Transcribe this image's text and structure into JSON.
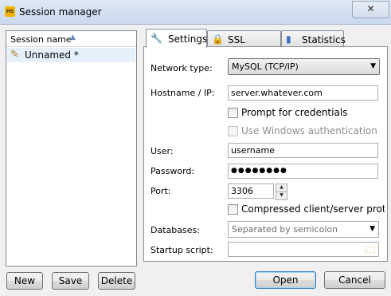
{
  "window": {
    "title": "Session manager",
    "app_icon": "HS",
    "close_glyph": "✕"
  },
  "session_list": {
    "header": "Session name",
    "items": [
      {
        "label": "Unnamed *"
      }
    ]
  },
  "tabs": [
    {
      "label": "Settings",
      "icon": "wrench-icon",
      "glyph": "🔧"
    },
    {
      "label": "SSL options",
      "icon": "lock-icon",
      "glyph": "🔒"
    },
    {
      "label": "Statistics",
      "icon": "bar-chart-icon",
      "glyph": "▮"
    }
  ],
  "settings": {
    "network_type": {
      "label": "Network type:",
      "value": "MySQL (TCP/IP)"
    },
    "hostname": {
      "label": "Hostname / IP:",
      "value": "server.whatever.com"
    },
    "prompt_credentials": {
      "label": "Prompt for credentials",
      "checked": false
    },
    "windows_auth": {
      "label": "Use Windows authentication",
      "checked": false,
      "disabled": true
    },
    "user": {
      "label": "User:",
      "value": "username"
    },
    "password": {
      "label": "Password:",
      "value": "●●●●●●●●"
    },
    "port": {
      "label": "Port:",
      "value": "3306"
    },
    "compressed": {
      "label": "Compressed client/server protoco",
      "checked": false
    },
    "databases": {
      "label": "Databases:",
      "placeholder": "Separated by semicolon"
    },
    "startup_script": {
      "label": "Startup script:",
      "value": ""
    }
  },
  "buttons": {
    "new": "New",
    "save": "Save",
    "delete": "Delete",
    "open": "Open",
    "cancel": "Cancel"
  },
  "colors": {
    "titlebar": "#c9d9ee",
    "selection": "#e5f0fb",
    "default_button_border": "#3c7fb1"
  }
}
